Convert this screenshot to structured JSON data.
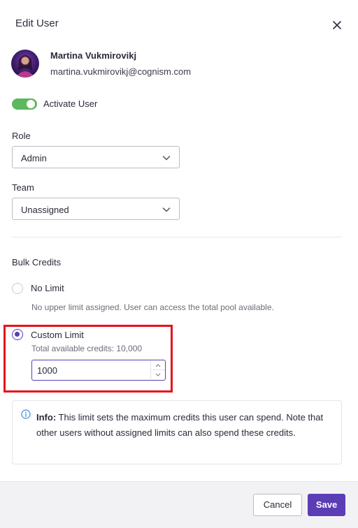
{
  "modal": {
    "title": "Edit User",
    "close_icon": "close-icon"
  },
  "user": {
    "name": "Martina Vukmirovikj",
    "email": "martina.vukmirovikj@cognism.com"
  },
  "activate": {
    "label": "Activate User",
    "enabled": true,
    "color": "#5cb85c"
  },
  "role": {
    "label": "Role",
    "value": "Admin"
  },
  "team": {
    "label": "Team",
    "value": "Unassigned"
  },
  "bulk_credits": {
    "label": "Bulk Credits",
    "no_limit": {
      "label": "No Limit",
      "helper": "No upper limit assigned. User can access the total pool available.",
      "selected": false
    },
    "custom_limit": {
      "label": "Custom Limit",
      "helper": "Total available credits: 10,000",
      "value": "1000",
      "selected": true
    }
  },
  "info": {
    "prefix": "Info:",
    "text": " This limit sets the maximum credits this user can spend. Note that other users without assigned limits can also spend these credits."
  },
  "footer": {
    "cancel_label": "Cancel",
    "save_label": "Save"
  },
  "colors": {
    "accent": "#5b3db5",
    "highlight": "#e8101a",
    "info": "#3a8fd9"
  }
}
